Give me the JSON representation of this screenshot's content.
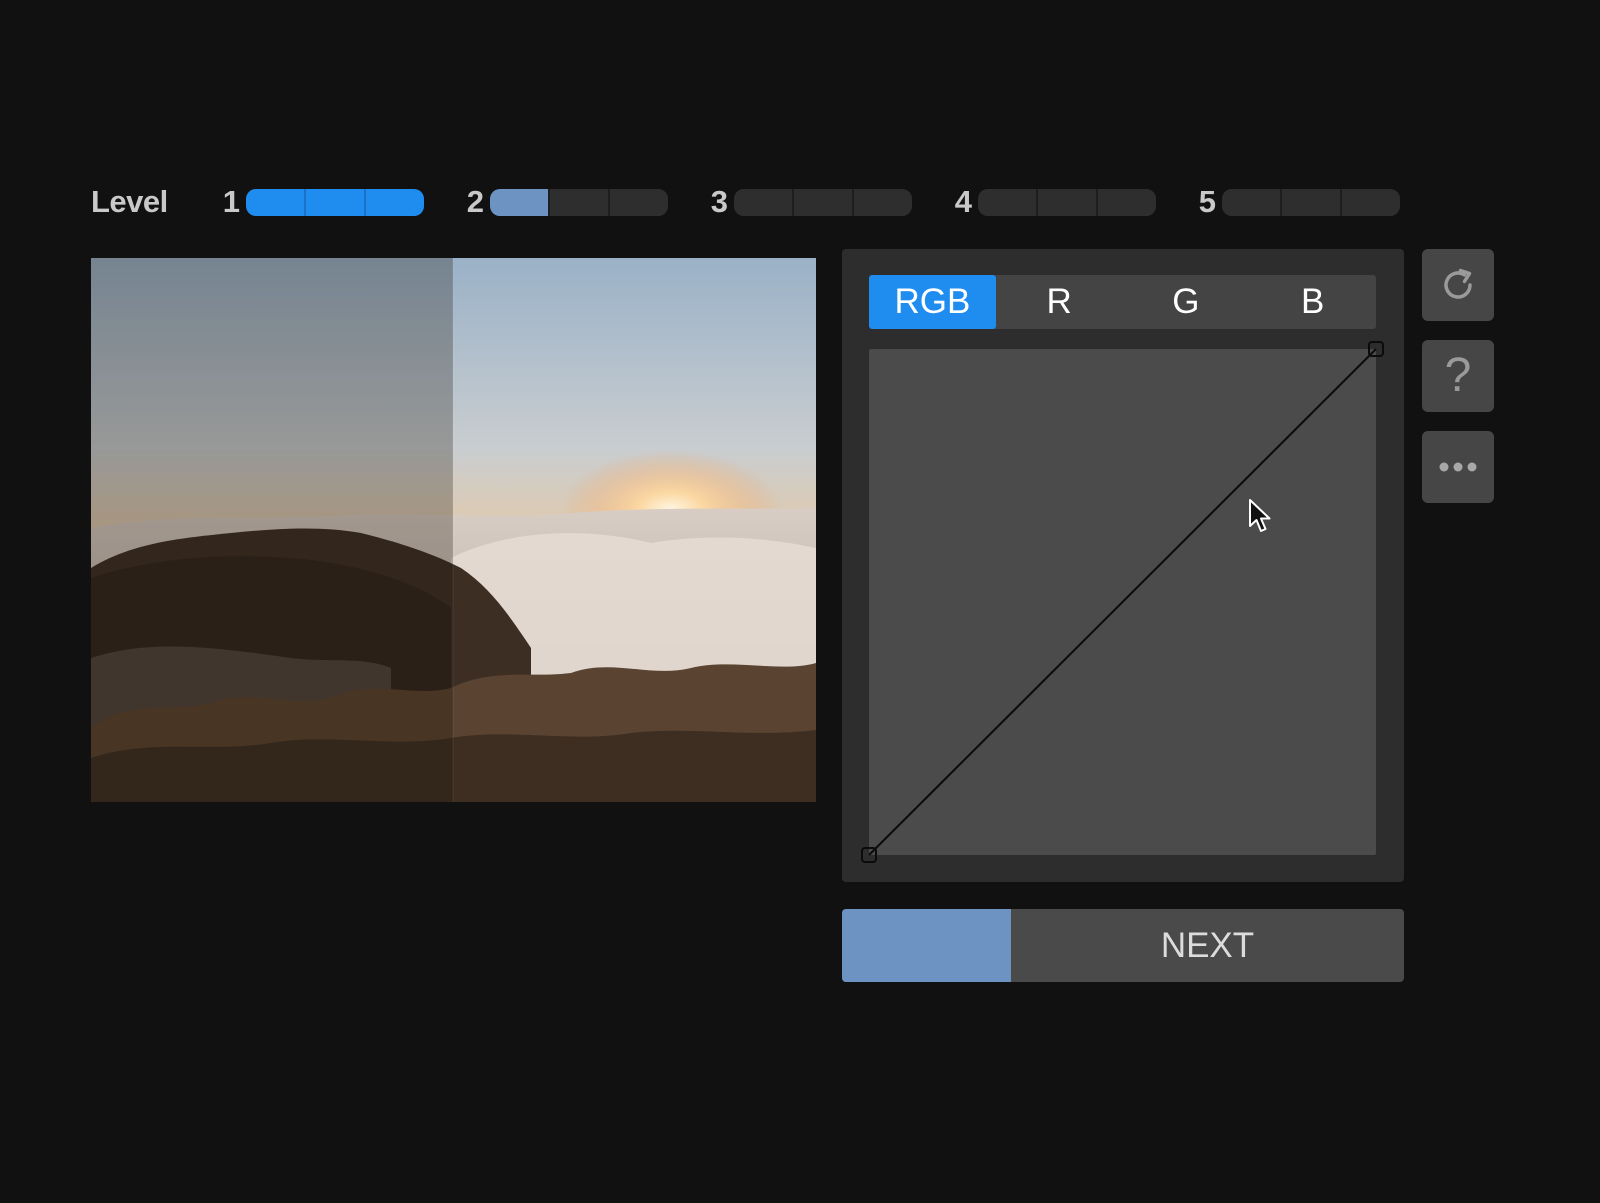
{
  "level": {
    "label": "Level",
    "groups": [
      {
        "number": "1",
        "segments_total": 3,
        "segments_done": 3,
        "current_fraction": 0
      },
      {
        "number": "2",
        "segments_total": 3,
        "segments_done": 0,
        "current_fraction": 0.333
      },
      {
        "number": "3",
        "segments_total": 3,
        "segments_done": 0,
        "current_fraction": 0
      },
      {
        "number": "4",
        "segments_total": 3,
        "segments_done": 0,
        "current_fraction": 0
      },
      {
        "number": "5",
        "segments_total": 3,
        "segments_done": 0,
        "current_fraction": 0
      }
    ]
  },
  "photo": {
    "subject": "sunrise over clouds and hills",
    "comparison_split": 0.5
  },
  "channels": {
    "tabs": [
      {
        "label": "RGB",
        "active": true
      },
      {
        "label": "R",
        "active": false
      },
      {
        "label": "G",
        "active": false
      },
      {
        "label": "B",
        "active": false
      }
    ]
  },
  "curve": {
    "points": [
      [
        0,
        0
      ],
      [
        255,
        255
      ]
    ]
  },
  "side_buttons": [
    {
      "name": "reset-button",
      "icon": "refresh-icon"
    },
    {
      "name": "help-button",
      "icon": "help-icon",
      "glyph": "?"
    },
    {
      "name": "more-button",
      "icon": "more-icon"
    }
  ],
  "next": {
    "label": "NEXT",
    "progress": 0.3
  },
  "colors": {
    "accent": "#1f8cf0",
    "accent_muted": "#6c93c2",
    "background": "#111112",
    "panel": "#2d2d2e"
  }
}
